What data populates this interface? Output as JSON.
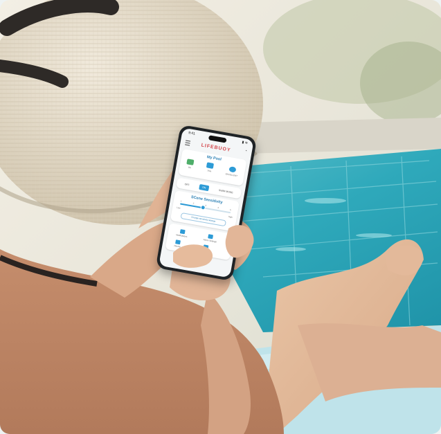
{
  "colors": {
    "brand_red": "#d3454a",
    "accent_blue": "#2d9bd6",
    "pool_water": "#3bb7c4"
  },
  "phone": {
    "status_time": "9:41",
    "app_logo": "LIFEBUOY",
    "pool_card": {
      "title": "My Pool",
      "items": [
        {
          "label": "OK",
          "icon": "pool-sensor-icon"
        },
        {
          "label": "75%",
          "icon": "battery-icon"
        },
        {
          "label": "EXCELLENT",
          "icon": "signal-icon"
        }
      ]
    },
    "modes": {
      "items": [
        "OFF",
        "ON",
        "SWIM MODE"
      ],
      "active_index": 1
    },
    "sensitivity": {
      "title": "SCene Sensitivity",
      "level": 0.45,
      "low_label": "Low",
      "high_label": "High",
      "ticks": [
        "1",
        "2",
        "3",
        "4",
        "5"
      ],
      "button_label": "Change sensitivity settings"
    },
    "bottom_items": [
      {
        "label": "Notifications",
        "icon": "bell-icon"
      },
      {
        "label": "Alarm Settings",
        "icon": "alarm-icon"
      },
      {
        "label": "Device",
        "icon": "device-icon"
      },
      {
        "label": "Support",
        "icon": "support-icon"
      }
    ]
  }
}
